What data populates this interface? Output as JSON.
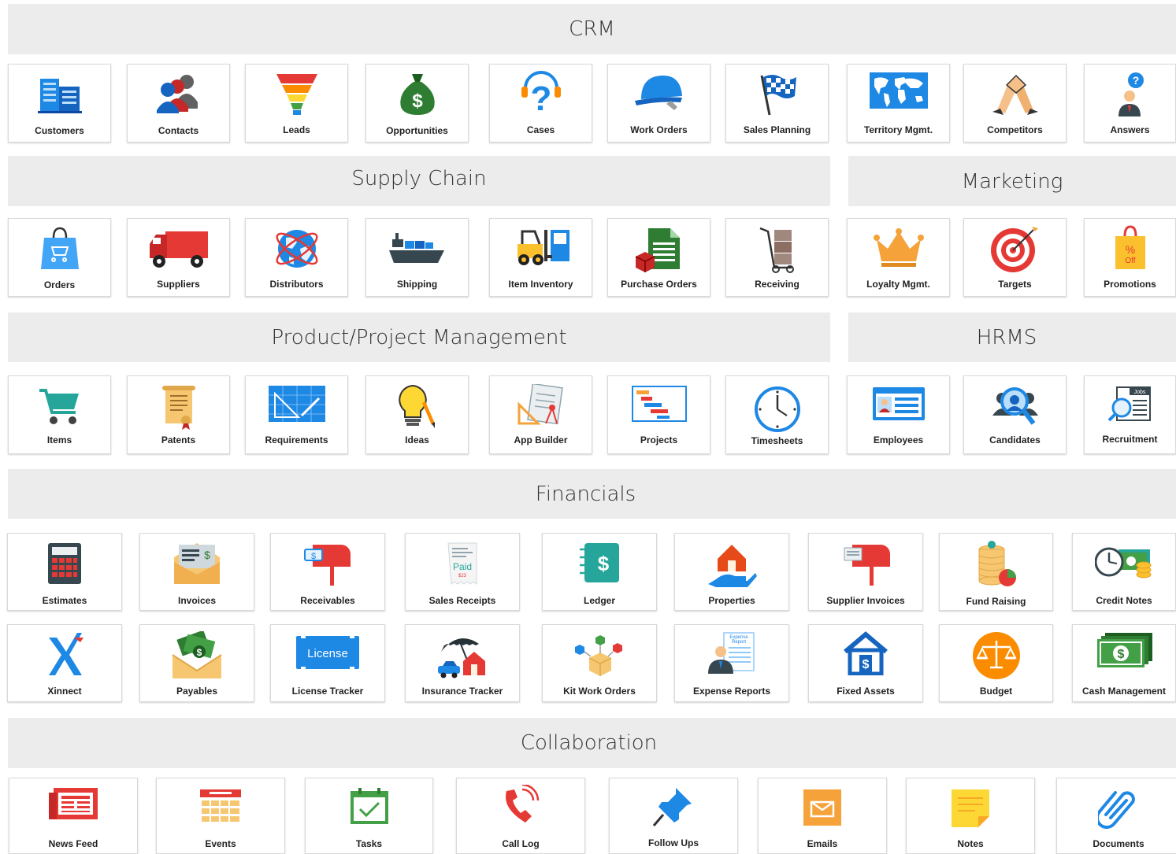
{
  "sections": {
    "crm": "CRM",
    "supply_chain": "Supply Chain",
    "marketing": "Marketing",
    "ppm": "Product/Project Management",
    "hrms": "HRMS",
    "financials": "Financials",
    "collaboration": "Collaboration"
  },
  "apps": {
    "customers": "Customers",
    "contacts": "Contacts",
    "leads": "Leads",
    "opportunities": "Opportunities",
    "cases": "Cases",
    "work_orders": "Work Orders",
    "sales_planning": "Sales Planning",
    "territory": "Territory Mgmt.",
    "competitors": "Competitors",
    "answers": "Answers",
    "orders": "Orders",
    "suppliers": "Suppliers",
    "distributors": "Distributors",
    "shipping": "Shipping",
    "item_inventory": "Item Inventory",
    "purchase_orders": "Purchase Orders",
    "receiving": "Receiving",
    "loyalty": "Loyalty Mgmt.",
    "targets": "Targets",
    "promotions": "Promotions",
    "items": "Items",
    "patents": "Patents",
    "requirements": "Requirements",
    "ideas": "Ideas",
    "app_builder": "App Builder",
    "projects": "Projects",
    "timesheets": "Timesheets",
    "employees": "Employees",
    "candidates": "Candidates",
    "recruitment": "Recruitment",
    "estimates": "Estimates",
    "invoices": "Invoices",
    "receivables": "Receivables",
    "sales_receipts": "Sales Receipts",
    "ledger": "Ledger",
    "properties": "Properties",
    "supplier_invoices": "Supplier Invoices",
    "fund_raising": "Fund Raising",
    "credit_notes": "Credit Notes",
    "xinnect": "Xinnect",
    "payables": "Payables",
    "license_tracker": "License Tracker",
    "insurance_tracker": "Insurance Tracker",
    "kit_work_orders": "Kit Work Orders",
    "expense_reports": "Expense Reports",
    "fixed_assets": "Fixed Assets",
    "budget": "Budget",
    "cash_management": "Cash Management",
    "news_feed": "News Feed",
    "events": "Events",
    "tasks": "Tasks",
    "call_log": "Call Log",
    "follow_ups": "Follow Ups",
    "emails": "Emails",
    "notes": "Notes",
    "documents": "Documents"
  },
  "icon_text": {
    "license": "License",
    "paid": "Paid",
    "paid_amount": "$23",
    "jobs": "Jobs",
    "off_pct": "%",
    "off": "Off",
    "expense": "Expense",
    "report": "Report",
    "dollar": "$",
    "question": "?"
  },
  "colors": {
    "band_bg": "#ececec",
    "tile_border": "#d9d9d9",
    "blue": "#1e88e5",
    "green": "#2e7d32",
    "red": "#e53935",
    "orange": "#f0a030"
  }
}
